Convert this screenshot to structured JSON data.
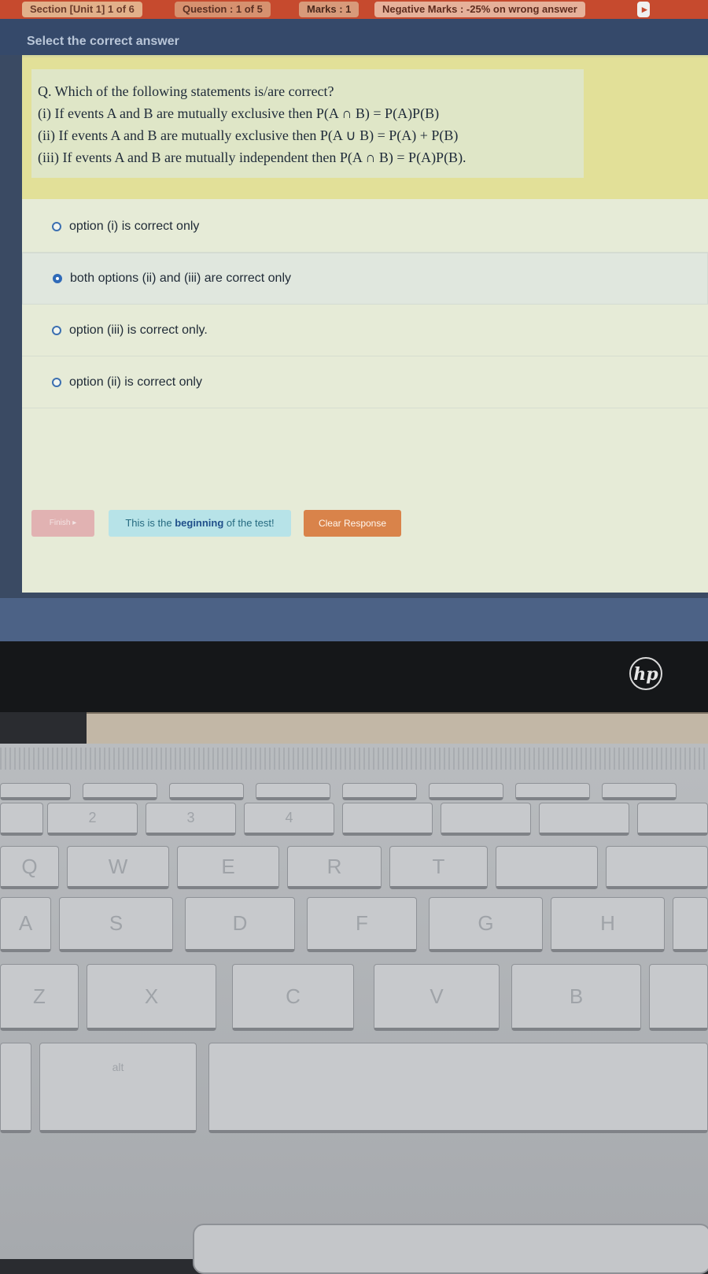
{
  "topbar": {
    "section": "Section [Unit 1] 1 of 6",
    "question": "Question : 1 of 5",
    "marks": "Marks : 1",
    "negative": "Negative Marks : -25% on wrong answer"
  },
  "instruction": "Select the correct answer",
  "question": {
    "lines": [
      "Q. Which of the following statements is/are correct?",
      "(i) If events A and B are mutually exclusive then P(A ∩ B) = P(A)P(B)",
      "(ii) If events A and B are mutually exclusive then P(A ∪ B) = P(A) + P(B)",
      "(iii) If events A and B are mutually independent then P(A ∩ B) = P(A)P(B)."
    ]
  },
  "options": [
    {
      "label": "option (i) is correct only",
      "selected": false
    },
    {
      "label": "both options (ii) and (iii) are correct only",
      "selected": true
    },
    {
      "label": "option (iii) is correct only.",
      "selected": false
    },
    {
      "label": "option (ii) is correct only",
      "selected": false
    }
  ],
  "actions": {
    "finish": "Finish",
    "info_prefix": "This is the ",
    "info_bold": "beginning",
    "info_suffix": " of the test!",
    "clear": "Clear Response"
  },
  "laptop": {
    "logo": "hp",
    "keys": [
      "2",
      "3",
      "4",
      "Q",
      "W",
      "E",
      "R",
      "T",
      "A",
      "S",
      "D",
      "F",
      "G",
      "H",
      "Z",
      "X",
      "C",
      "V",
      "B",
      "alt"
    ]
  }
}
